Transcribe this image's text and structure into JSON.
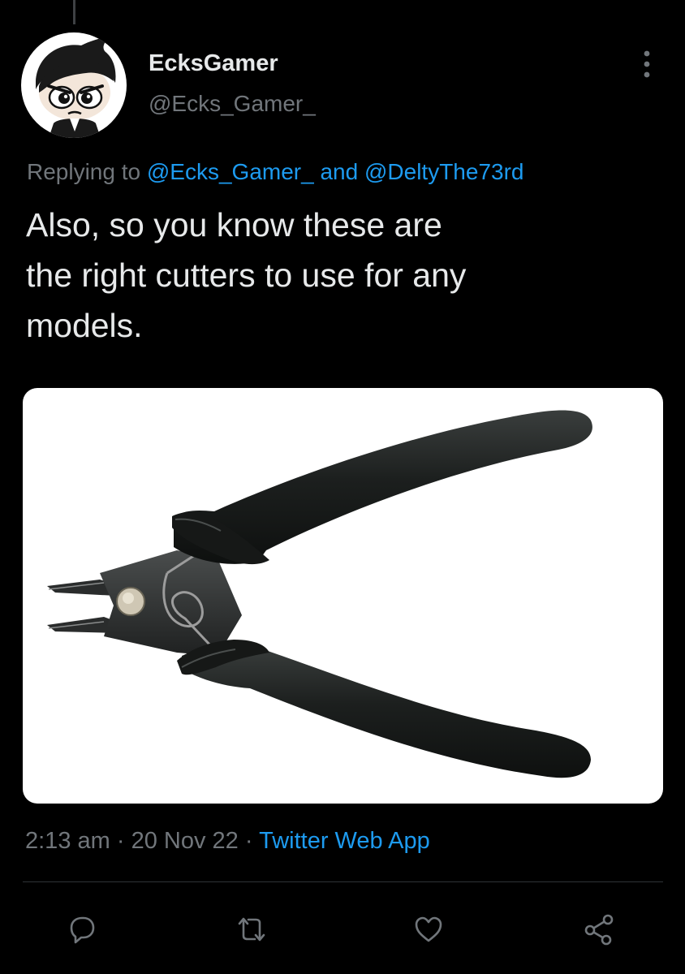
{
  "author": {
    "display_name": "EcksGamer",
    "handle": "@Ecks_Gamer_"
  },
  "reply": {
    "prefix": "Replying to",
    "mention_1": "@Ecks_Gamer_",
    "conjunction": "and",
    "mention_2": "@DeltyThe73rd"
  },
  "tweet": {
    "lines": [
      "Also, so you know these are",
      "the right cutters to use for any",
      "models."
    ]
  },
  "meta": {
    "time": "2:13 am",
    "separator": "·",
    "date": "20 Nov 22",
    "source": "Twitter Web App"
  },
  "actions": {
    "icons": [
      "reply-icon",
      "retweet-icon",
      "like-icon",
      "share-icon"
    ]
  },
  "colors": {
    "background": "#000000",
    "text": "#e7e9ea",
    "secondary": "#71767b",
    "accent": "#1d9bf0",
    "divider": "#2f3336"
  }
}
